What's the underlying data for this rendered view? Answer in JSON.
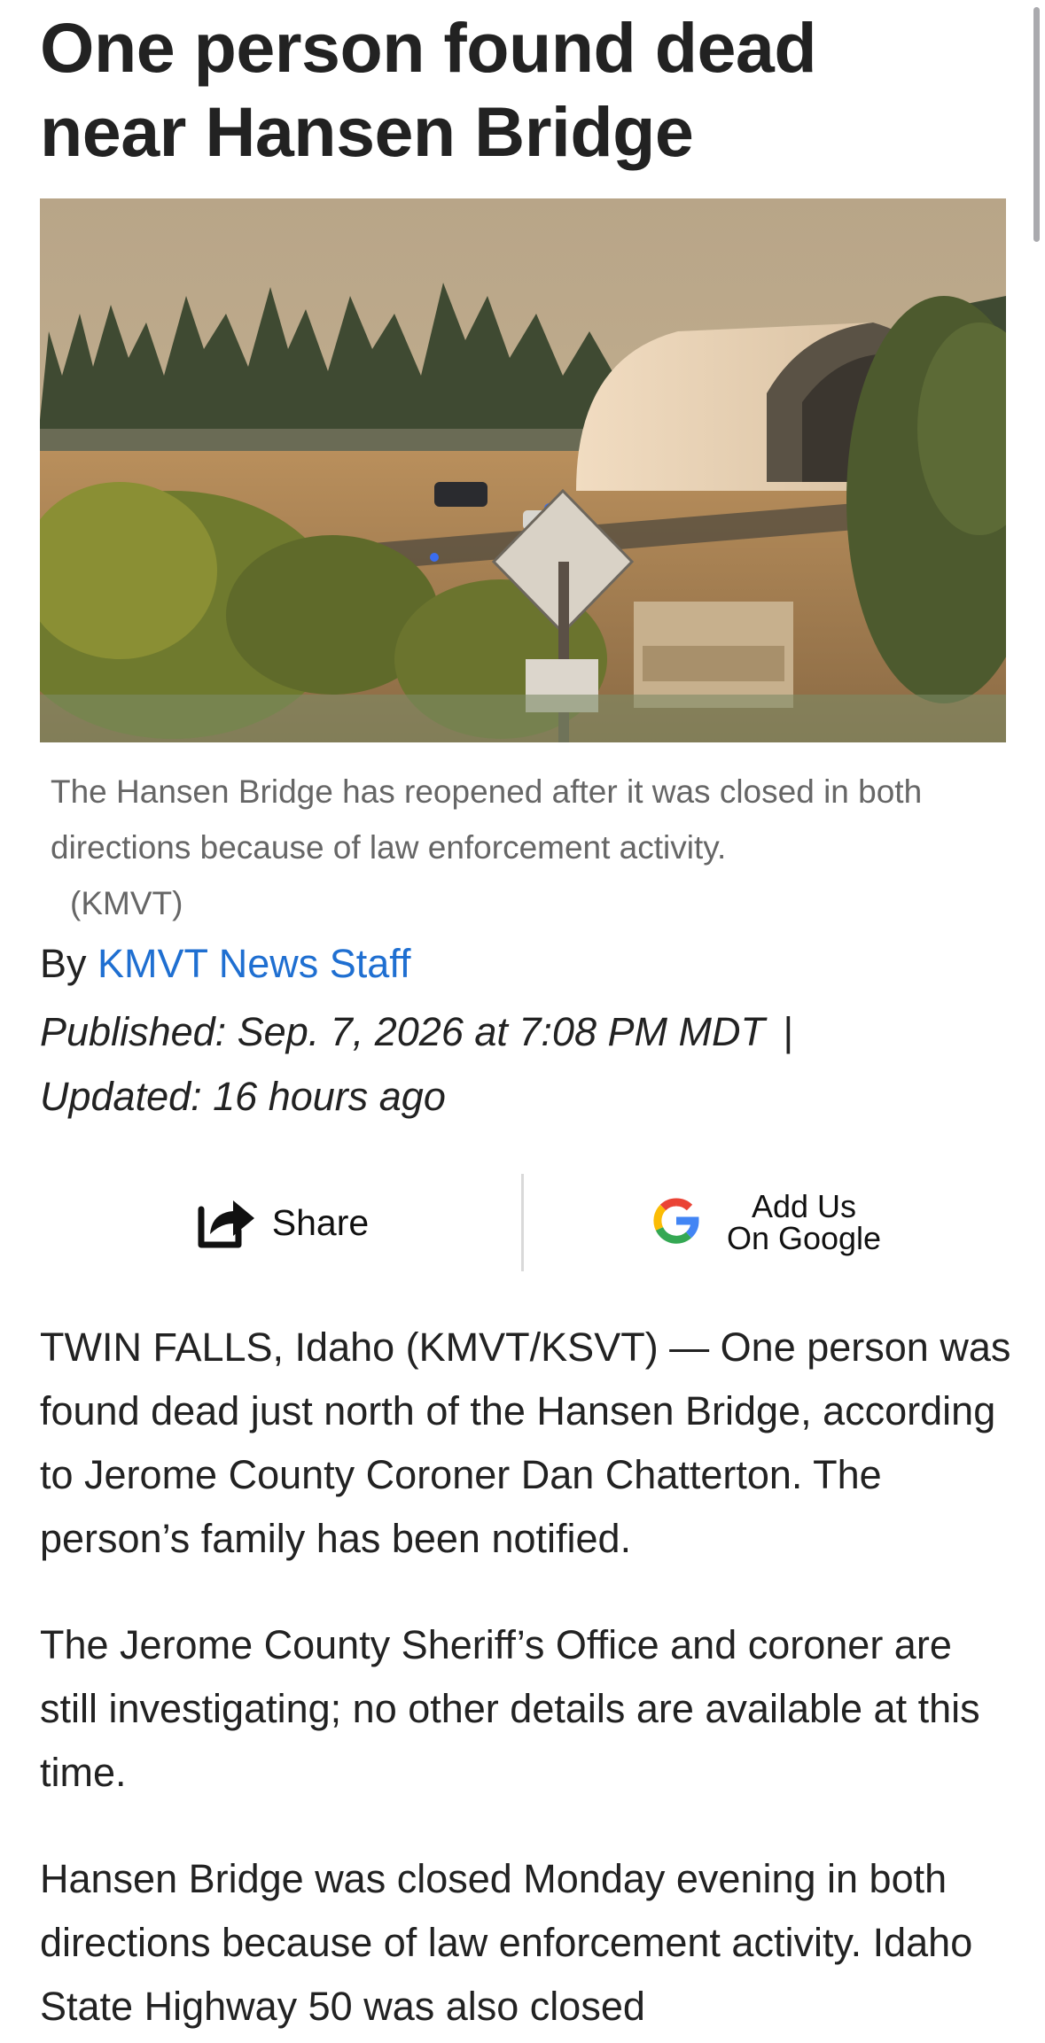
{
  "article": {
    "headline": "One person found dead near Hansen Bridge",
    "image_caption": "The Hansen Bridge has reopened after it was closed in both directions because of law enforcement activity.",
    "image_credit": "(KMVT)",
    "byline_prefix": "By",
    "author": "KMVT News Staff",
    "published": "Published: Sep. 7, 2026 at 7:08 PM MDT",
    "separator": "|",
    "updated": "Updated: 16 hours ago",
    "paragraphs": [
      "TWIN FALLS, Idaho (KMVT/KSVT) — One person was found dead just north of the Hansen Bridge, according to Jerome County Coroner Dan Chatterton. The person’s family has been notified.",
      "The Jerome County Sheriff’s Office and coroner are still investigating; no other details are available at this time.",
      "Hansen Bridge was closed Monday evening in both directions because of law enforcement activity. Idaho State Highway 50 was also closed"
    ]
  },
  "actions": {
    "share_label": "Share",
    "google_line1": "Add Us",
    "google_line2": "On Google",
    "share_icon": "share-icon",
    "google_icon": "google-icon"
  },
  "colors": {
    "link": "#1f6fd1",
    "caption": "#666666",
    "text": "#222222",
    "divider": "#d9d9d9"
  }
}
